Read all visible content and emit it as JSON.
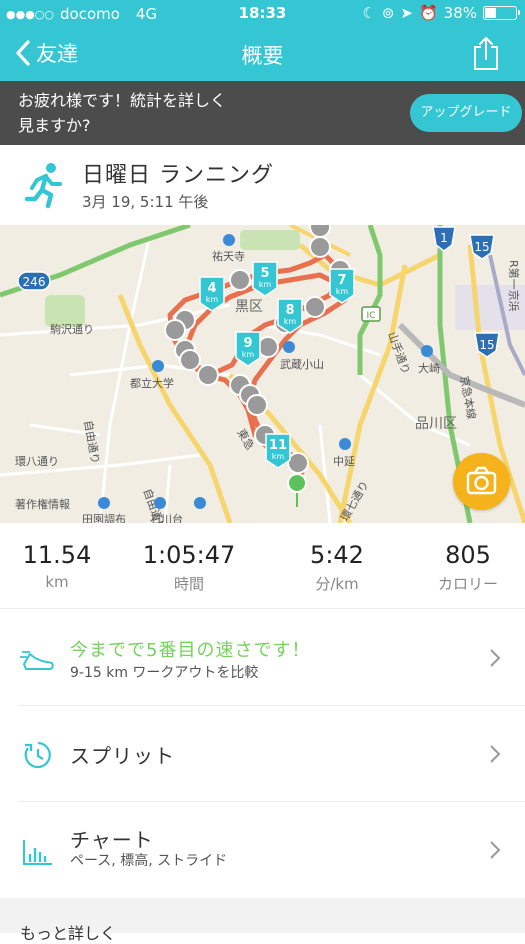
{
  "status_bar": {
    "carrier": "docomo",
    "network": "4G",
    "time": "18:33",
    "battery": "38%",
    "battery_level": 0.38
  },
  "nav": {
    "back_label": "友達",
    "title": "概要"
  },
  "banner": {
    "line1": "お疲れ様です！統計を詳しく",
    "line2": "見ますか?",
    "button_label": "アップグレード"
  },
  "workout": {
    "title": "日曜日 ランニング",
    "date": "3月 19, 5:11 午後"
  },
  "map": {
    "labels": {
      "yutenji": "祐天寺",
      "meguro_ku": "黒区",
      "komazawa": "駒沢通り",
      "toritsu": "都立大学",
      "jiyudori": "自由通り",
      "kanpachi": "環八通り",
      "chosaku": "著作権情報",
      "denen": "田園調布",
      "ishikawadai": "石川台",
      "musashikoyama": "武蔵小山",
      "nakanobu": "中延",
      "kannana": "環七通り",
      "shinagawa": "品川区",
      "osaki": "大崎",
      "yamate": "山手通り",
      "keikyu": "京急本線",
      "meguro_dori": "目黒通り",
      "jiyudori2": "自由通り",
      "r_dai": "R第一京浜",
      "higashi": "東急",
      "ic": "IC"
    },
    "route_shields": {
      "r246": "246",
      "r1": "1",
      "r15a": "15",
      "r15b": "15"
    },
    "km_markers": [
      "4",
      "5",
      "7",
      "8",
      "9",
      "11"
    ],
    "km_unit": "km"
  },
  "stats": {
    "distance": {
      "value": "11.54",
      "unit": "km"
    },
    "duration": {
      "value": "1:05:47",
      "unit": "時間"
    },
    "pace": {
      "value": "5:42",
      "unit": "分/km"
    },
    "calories": {
      "value": "805",
      "unit": "カロリー"
    }
  },
  "rows": {
    "achievement": {
      "title": "今までで5番目の速さです！",
      "sub": "9-15 km ワークアウトを比較"
    },
    "splits": {
      "label": "スプリット"
    },
    "chart": {
      "label": "チャート",
      "sub": "ペース, 標高, ストライド"
    }
  },
  "more": {
    "label": "もっと詳しく"
  },
  "colors": {
    "accent": "#34c6d3",
    "achievement_green": "#74d35a",
    "route": "#e8704f",
    "camera": "#f6b21a",
    "banner_bg": "#4c4c4c"
  }
}
